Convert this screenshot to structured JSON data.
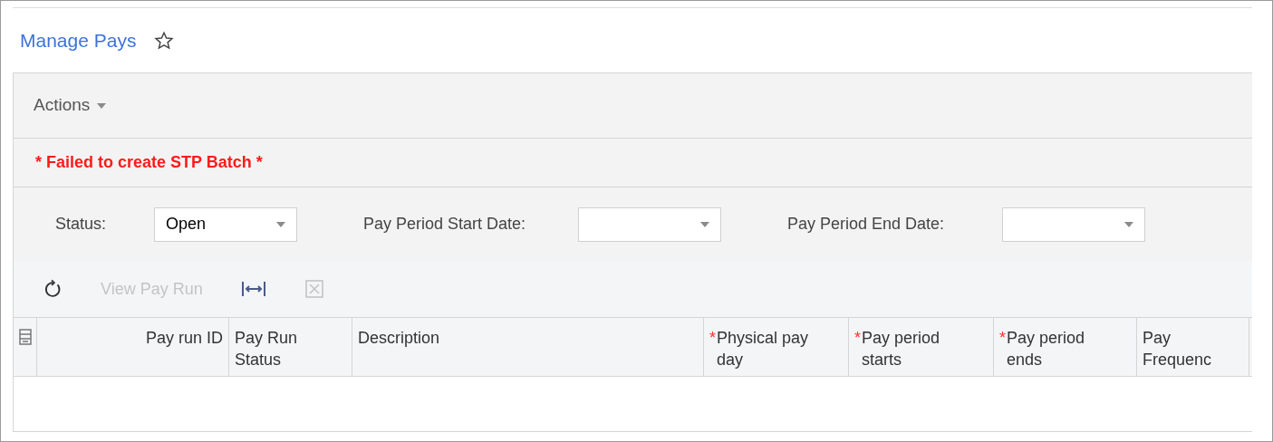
{
  "page_title": "Manage Pays",
  "favorite": false,
  "actions_menu": {
    "label": "Actions"
  },
  "error_message": "* Failed to create STP Batch *",
  "filters": [
    {
      "label": "Status:",
      "value": "Open"
    },
    {
      "label": "Pay Period Start Date:"
    },
    {
      "label": "Pay Period End Date:"
    }
  ],
  "toolbar": [
    {
      "kind": "refresh",
      "disabled": false
    },
    {
      "kind": "text",
      "label": "View Pay Run",
      "disabled": true
    },
    {
      "kind": "fit-columns",
      "disabled": false
    },
    {
      "kind": "export",
      "disabled": true
    }
  ],
  "table": {
    "columns": [
      {
        "label": "Pay run ID",
        "required": false,
        "kind": "id"
      },
      {
        "label": "Pay Run Status",
        "required": false,
        "kind": "text"
      },
      {
        "label": "Description",
        "required": false,
        "kind": "text"
      },
      {
        "label": "Physical pay day",
        "required": true,
        "required_mark": "*",
        "kind": "text"
      },
      {
        "label": "Pay period starts",
        "required": true,
        "required_mark": "*",
        "kind": "text"
      },
      {
        "label": "Pay period ends",
        "required": true,
        "required_mark": "*",
        "kind": "text"
      },
      {
        "label": "Pay Frequenc",
        "required": false,
        "kind": "text"
      }
    ]
  }
}
